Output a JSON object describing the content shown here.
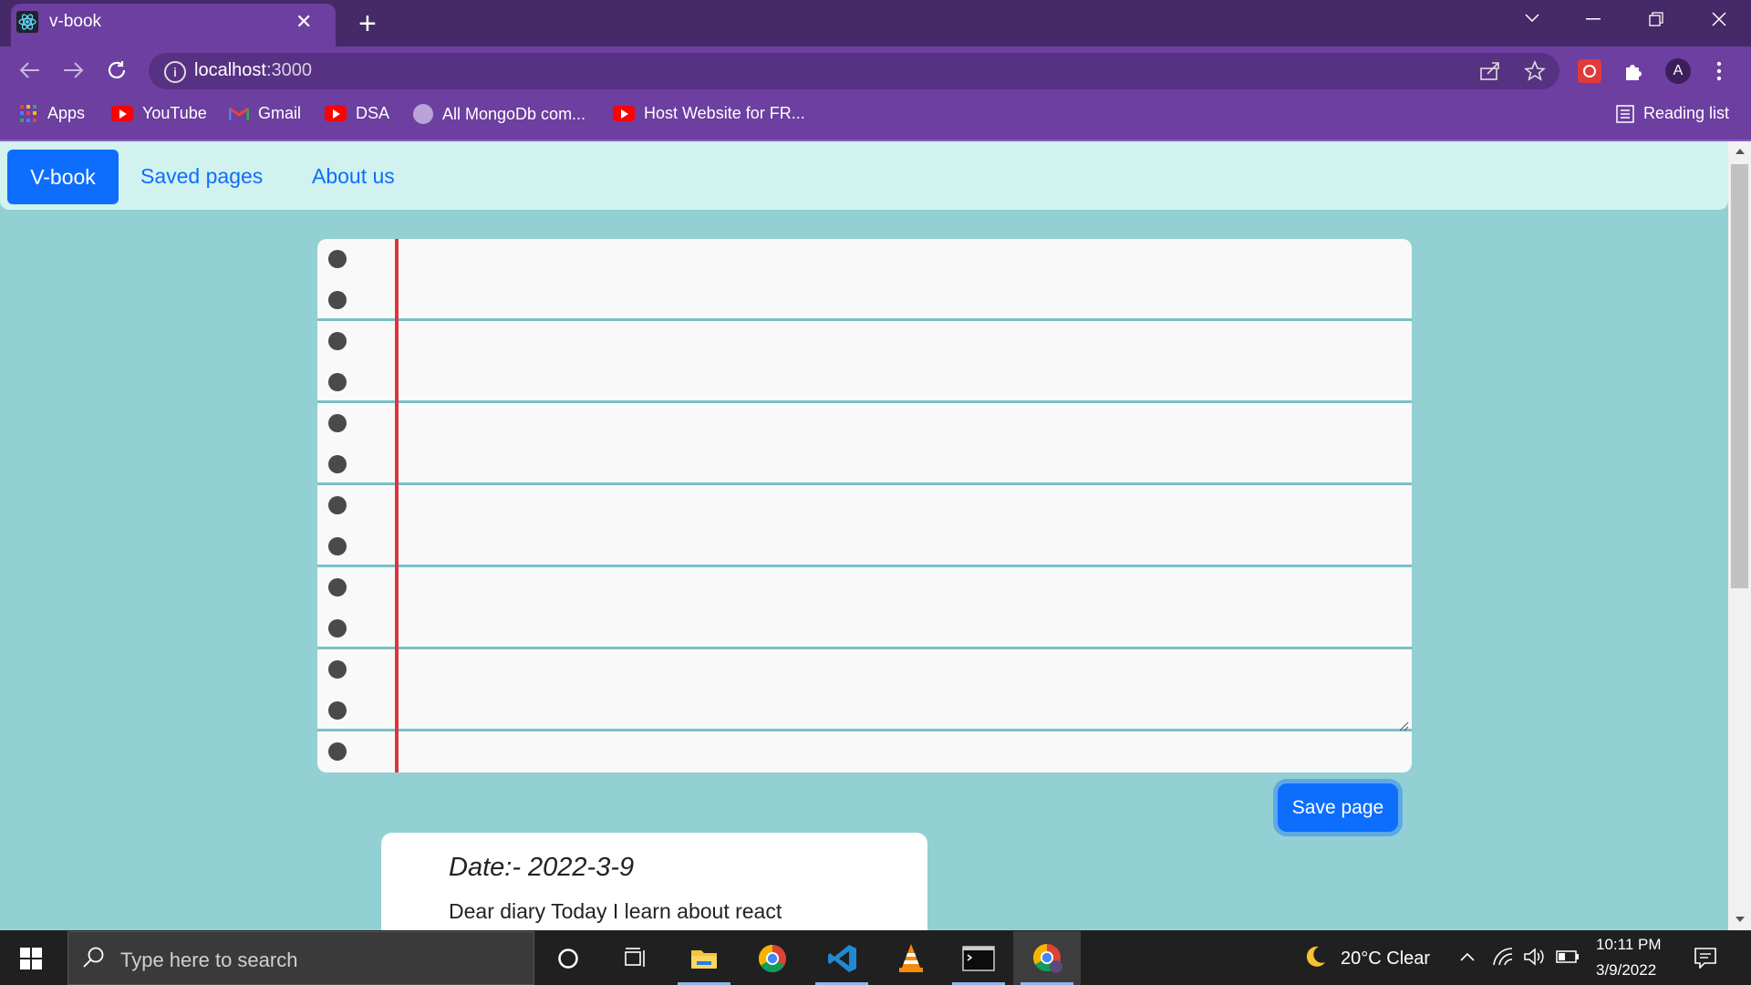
{
  "browser": {
    "tab_title": "v-book",
    "tab_close": "✕",
    "new_tab": "+",
    "url_host": "localhost",
    "url_port": ":3000",
    "info_glyph": "i",
    "bookmarks": [
      {
        "label": "Apps",
        "icon": "apps-grid-icon"
      },
      {
        "label": "YouTube",
        "icon": "youtube-icon"
      },
      {
        "label": "Gmail",
        "icon": "gmail-icon"
      },
      {
        "label": "DSA",
        "icon": "youtube-icon"
      },
      {
        "label": "All MongoDb com...",
        "icon": "mongodb-avatar-icon"
      },
      {
        "label": "Host Website for FR...",
        "icon": "youtube-icon"
      }
    ],
    "reading_list": "Reading list",
    "profile_initial": "A"
  },
  "app": {
    "brand": "V-book",
    "nav_links": [
      "Saved pages",
      "About us"
    ],
    "notebook_text": "",
    "save_button": "Save page",
    "entry": {
      "date": "Date:- 2022-3-9",
      "text": "Dear diary Today I learn about react"
    }
  },
  "taskbar": {
    "search_placeholder": "Type here to search",
    "weather": "20°C  Clear",
    "time": "10:11 PM",
    "date": "3/9/2022"
  },
  "colors": {
    "browser_frame": "#6c3fa0",
    "tab_strip": "#462968",
    "app_background": "#92d0d3",
    "navbar_background": "#d2f2f0",
    "primary": "#0d6efd",
    "notebook_rule": "#77c1c6",
    "notebook_margin": "#d9373d"
  }
}
